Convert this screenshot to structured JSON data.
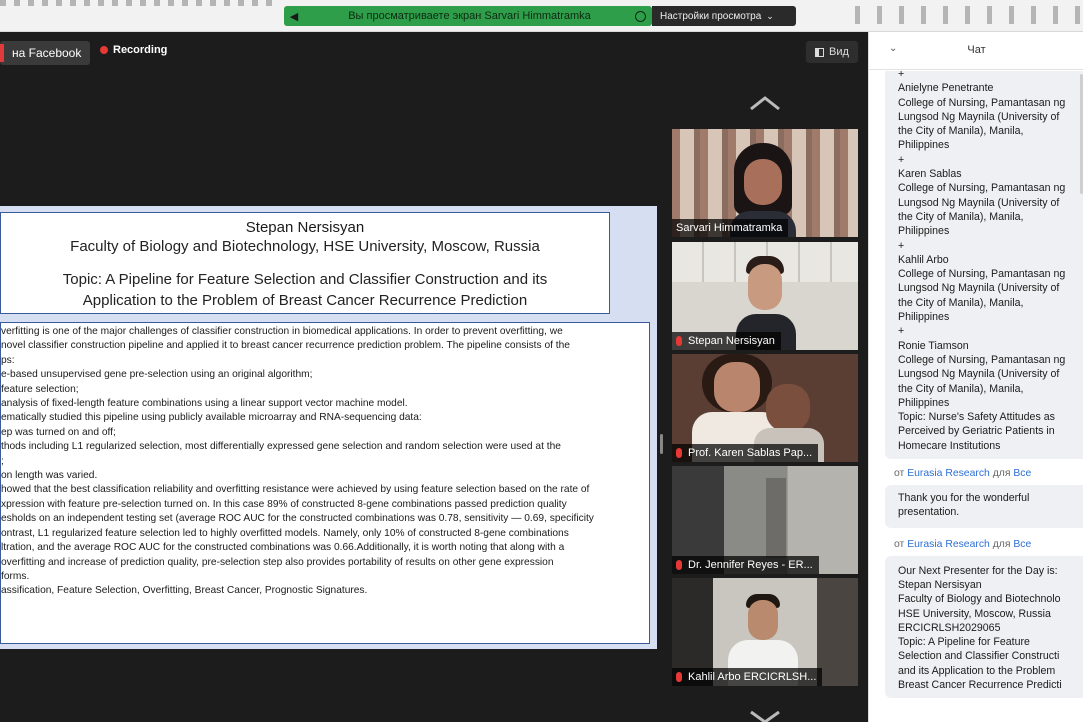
{
  "share_banner": {
    "text": "Вы просматриваете экран Sarvari Himmatramka",
    "view_options": "Настройки просмотра"
  },
  "toolbar": {
    "facebook": "на Facebook",
    "recording": "Recording",
    "view": "Вид"
  },
  "slide": {
    "name": "Stepan Nersisyan",
    "affiliation": "Faculty of Biology and Biotechnology, HSE University, Moscow, Russia",
    "topic_line1": "Topic: A Pipeline for Feature Selection and Classifier Construction and its",
    "topic_line2": "Application to the Problem of Breast Cancer Recurrence Prediction",
    "body": [
      "verfitting is one of the major challenges of classifier construction in biomedical applications. In order to prevent overfitting, we",
      "novel classifier construction pipeline and applied it to breast cancer recurrence prediction problem. The pipeline consists of the",
      "ps:",
      "e-based unsupervised gene pre-selection using an original algorithm;",
      "feature selection;",
      "analysis of fixed-length feature combinations using a linear support vector machine model.",
      "ematically studied this pipeline using publicly available microarray and RNA-sequencing data:",
      "ep was turned on and off;",
      "thods including L1 regularized selection, most differentially expressed gene selection and random selection were used at the",
      ";",
      "on length was varied.",
      "howed that the best classification reliability and overfitting resistance were achieved by using feature selection based on the rate of",
      "xpression with feature pre-selection turned on. In this case 89% of constructed 8-gene combinations passed prediction quality",
      "esholds on an independent testing set (average ROC AUC for the constructed combinations was 0.78, sensitivity — 0.69, specificity",
      "ontrast, L1 regularized feature selection led to highly overfitted models. Namely, only 10% of constructed 8-gene combinations",
      "ltration, and the average ROC AUC for the constructed combinations was 0.66.Additionally, it is worth noting that along with a",
      "overfitting and increase of prediction quality, pre-selection step also provides portability of results on other gene expression",
      "forms.",
      "assification, Feature Selection, Overfitting, Breast Cancer, Prognostic Signatures."
    ]
  },
  "participants": [
    {
      "name": "Sarvari Himmatramka",
      "active": true
    },
    {
      "name": "Stepan Nersisyan",
      "active": false
    },
    {
      "name": "Prof. Karen Sablas Pap...",
      "active": false
    },
    {
      "name": "Dr. Jennifer Reyes - ER...",
      "active": false
    },
    {
      "name": "Kahlil Arbo ERCICRLSH...",
      "active": false
    }
  ],
  "chat": {
    "title": "Чат",
    "message1": [
      "+",
      "Anielyne Penetrante",
      "College of Nursing, Pamantasan ng",
      "Lungsod Ng Maynila (University of",
      "the City of Manila), Manila,",
      "Philippines",
      "+",
      "Karen Sablas",
      "College of Nursing, Pamantasan ng",
      "Lungsod Ng Maynila (University of",
      "the City of Manila), Manila,",
      "Philippines",
      "+",
      "Kahlil Arbo",
      "College of Nursing, Pamantasan ng",
      "Lungsod Ng Maynila (University of",
      "the City of Manila), Manila,",
      "Philippines",
      "+",
      "Ronie Tiamson",
      "College of Nursing, Pamantasan ng",
      "Lungsod Ng Maynila (University of",
      "the City of Manila), Manila,",
      "Philippines",
      "Topic: Nurse's Safety Attitudes as",
      "Perceived by Geriatric Patients in",
      "Homecare Institutions"
    ],
    "meta_from": "от",
    "meta_sender": "Eurasia Research",
    "meta_for": "для",
    "meta_all": "Все",
    "message2": [
      "Thank you for the wonderful",
      "presentation."
    ],
    "message3": [
      "Our Next Presenter for the Day is:",
      "Stepan Nersisyan",
      "Faculty of Biology and Biotechnolo",
      "HSE University, Moscow, Russia",
      "ERCICRLSH2029065",
      "Topic: A Pipeline for Feature",
      "Selection and Classifier Constructi",
      "and its Application to the Problem",
      "Breast Cancer Recurrence Predicti"
    ]
  }
}
